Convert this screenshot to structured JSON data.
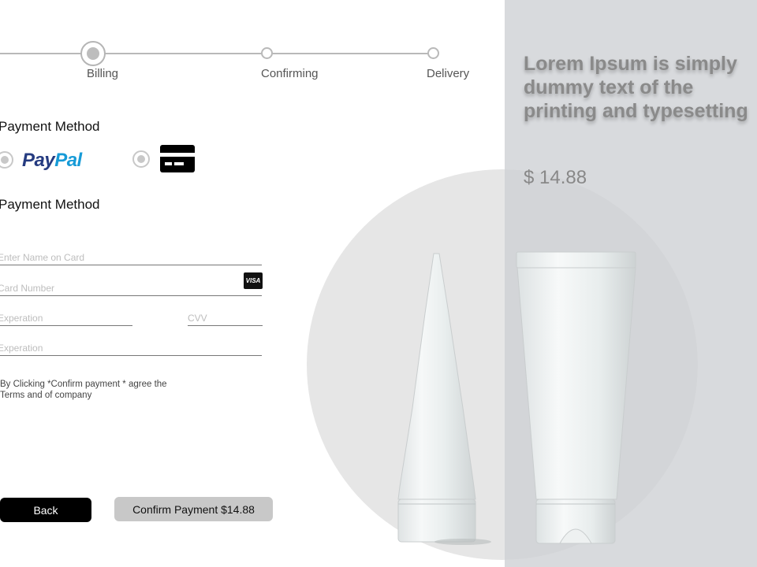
{
  "stepper": {
    "steps": [
      {
        "label": "Billing",
        "state": "active"
      },
      {
        "label": "Confirming",
        "state": "pending"
      },
      {
        "label": "Delivery",
        "state": "pending"
      }
    ]
  },
  "payment_method": {
    "title": "Payment Method",
    "options": [
      {
        "name": "PayPal",
        "brand_part1": "Pay",
        "brand_part2": "Pal",
        "icon": "paypal-logo"
      },
      {
        "name": "Credit Card",
        "icon": "credit-card-icon"
      }
    ]
  },
  "card_form": {
    "title": "Payment Method",
    "name_placeholder": "Enter Name on Card",
    "number_placeholder": "Card Number",
    "card_brand": "VISA",
    "expiration_placeholder": "Experation",
    "cvv_placeholder": "CVV",
    "expiration2_placeholder": "Experation"
  },
  "terms": {
    "line1": "By Clicking *Confirm payment * agree the",
    "line2": "Terms and of company"
  },
  "buttons": {
    "back": "Back",
    "confirm": "Confirm Payment $14.88"
  },
  "product": {
    "title": "Lorem Ipsum is simply dummy text of the printing and typesetting",
    "price": "$ 14.88"
  },
  "colors": {
    "primary_button": "#000000",
    "secondary_button": "#c8c8c8",
    "right_panel": "#d8dadd",
    "paypal_dark": "#253b80",
    "paypal_light": "#179bd7"
  }
}
